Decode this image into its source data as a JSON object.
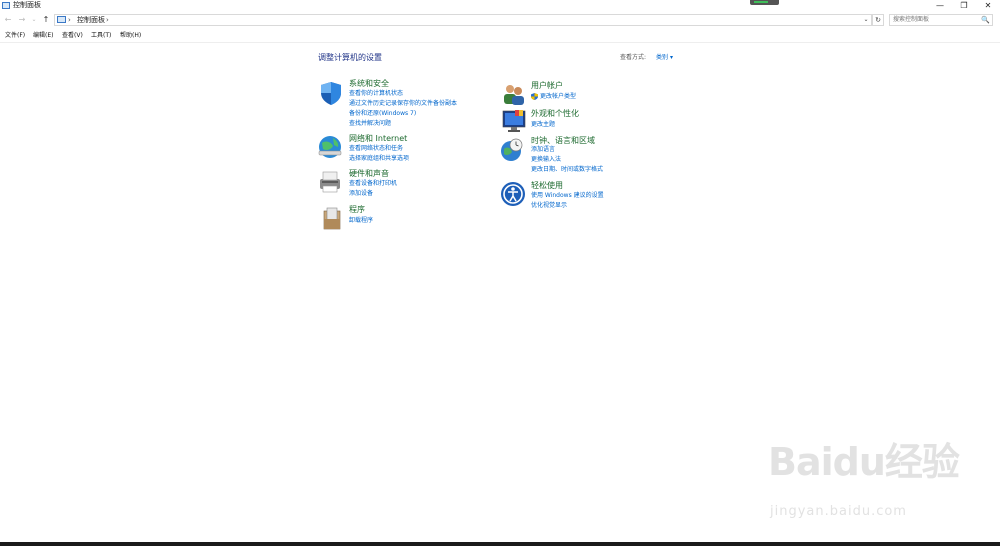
{
  "window": {
    "title": "控制面板",
    "icon": "control-panel-icon",
    "buttons": {
      "minimize": "—",
      "restore": "❐",
      "close": "✕"
    }
  },
  "nav": {
    "back": "←",
    "forward": "→",
    "recent": "⌄",
    "up": "↑"
  },
  "address": {
    "separator": "›",
    "path": "控制面板",
    "dropdown": "⌄",
    "refresh": "↻"
  },
  "search": {
    "placeholder": "搜索控制面板",
    "icon": "🔍"
  },
  "menu": [
    "文件(F)",
    "编辑(E)",
    "查看(V)",
    "工具(T)",
    "帮助(H)"
  ],
  "main": {
    "heading": "调整计算机的设置",
    "view_by_label": "查看方式:",
    "view_by_value": "类别",
    "view_by_caret": "▾",
    "left": [
      {
        "title": "系统和安全",
        "icon": "shield-icon",
        "links": [
          "查看你的计算机状态",
          "通过文件历史记录保存你的文件备份副本",
          "备份和还原(Windows 7)",
          "查找并解决问题"
        ]
      },
      {
        "title": "网络和 Internet",
        "icon": "network-globe-icon",
        "links": [
          "查看网络状态和任务",
          "选择家庭组和共享选项"
        ]
      },
      {
        "title": "硬件和声音",
        "icon": "printer-icon",
        "links": [
          "查看设备和打印机",
          "添加设备"
        ]
      },
      {
        "title": "程序",
        "icon": "programs-box-icon",
        "links": [
          "卸载程序"
        ]
      }
    ],
    "right": [
      {
        "title": "用户帐户",
        "icon": "users-icon",
        "links": [
          "更改帐户类型"
        ]
      },
      {
        "title": "外观和个性化",
        "icon": "monitor-icon",
        "links": [
          "更改主题"
        ]
      },
      {
        "title": "时钟、语言和区域",
        "icon": "clock-globe-icon",
        "links": [
          "添加语言",
          "更换输入法",
          "更改日期、时间或数字格式"
        ]
      },
      {
        "title": "轻松使用",
        "icon": "accessibility-icon",
        "links": [
          "使用 Windows 建议的设置",
          "优化视觉显示"
        ]
      }
    ]
  },
  "watermark": {
    "logo": "Baidu经验",
    "url": "jingyan.baidu.com"
  },
  "colors": {
    "heading": "#1e3287",
    "category_title": "#1d6a2f",
    "link": "#0066cc"
  }
}
